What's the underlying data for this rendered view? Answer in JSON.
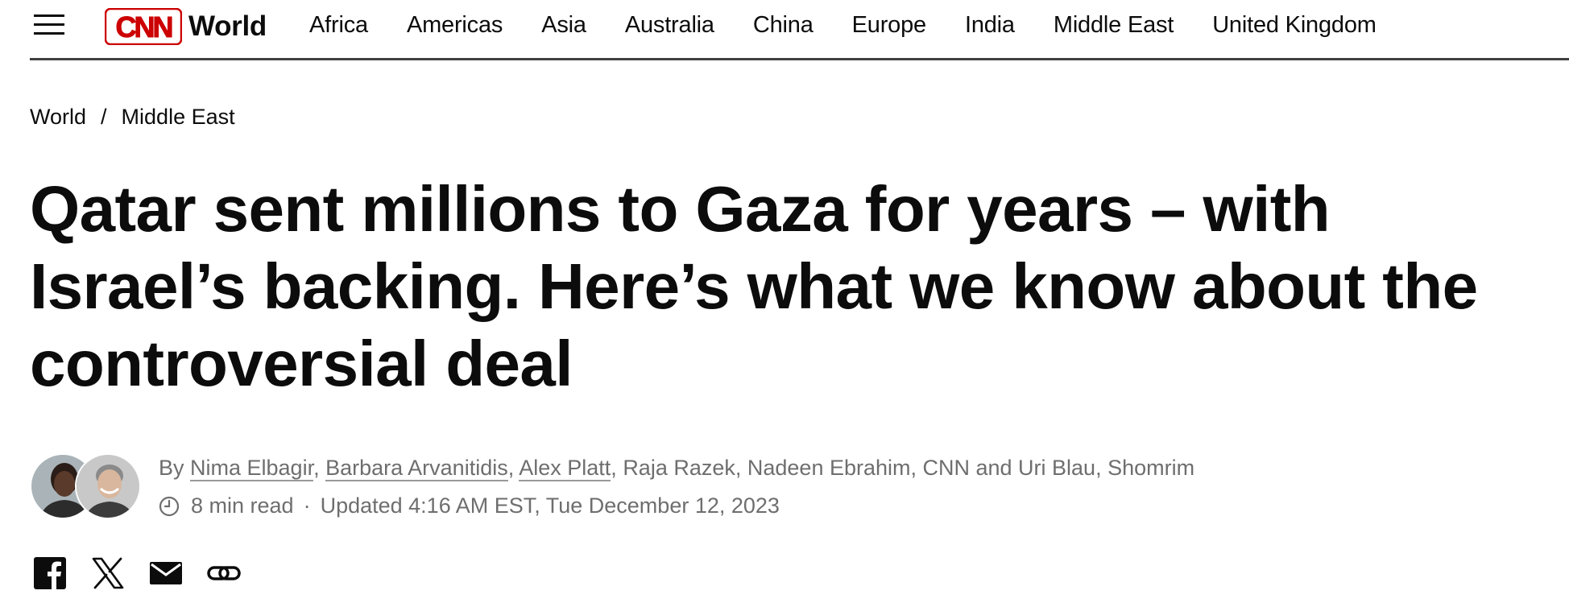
{
  "header": {
    "menu_icon": "hamburger-menu-icon",
    "logo_text": "CNN",
    "brand_color": "#cc0000",
    "section_name": "World",
    "nav_items": [
      "Africa",
      "Americas",
      "Asia",
      "Australia",
      "China",
      "Europe",
      "India",
      "Middle East",
      "United Kingdom"
    ]
  },
  "breadcrumb": {
    "items": [
      "World",
      "Middle East"
    ],
    "separator": "/"
  },
  "article": {
    "headline": "Qatar sent millions to Gaza for years – with Israel’s backing. Here’s what we know about the controversial deal",
    "byline": {
      "prefix": "By",
      "linked_authors": [
        "Nima Elbagir",
        "Barbara Arvanitidis",
        "Alex Platt"
      ],
      "separator": ",",
      "unlinked_text": "Raja Razek, Nadeen Ebrahim, CNN and Uri Blau, Shomrim"
    },
    "read_time": "8 min read",
    "meta_separator": "·",
    "updated": "Updated 4:16 AM EST, Tue December 12, 2023",
    "clock_icon": "clock-icon"
  },
  "share": {
    "icons": [
      "facebook-icon",
      "x-twitter-icon",
      "email-icon",
      "link-icon"
    ]
  }
}
